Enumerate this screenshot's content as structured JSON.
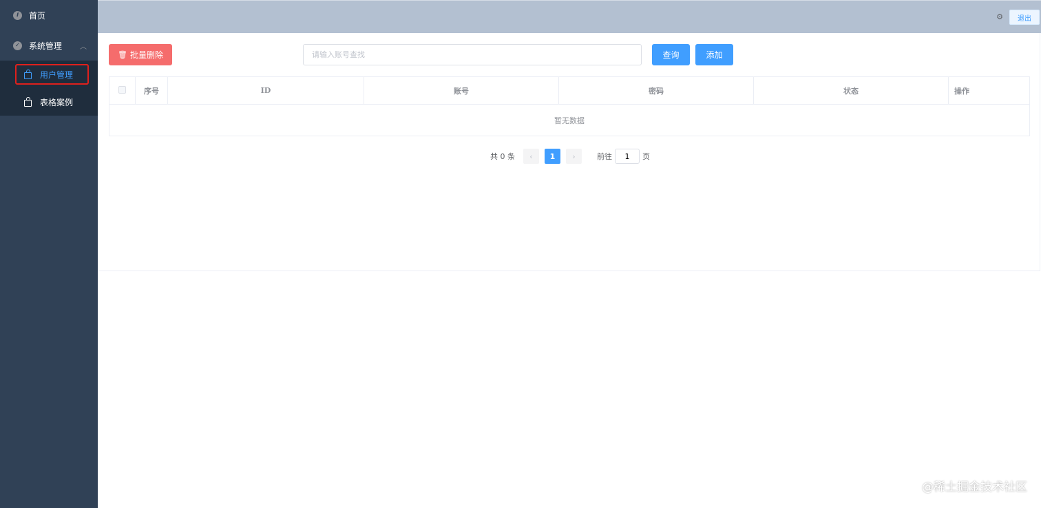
{
  "sidebar": {
    "items": [
      {
        "label": "首页",
        "icon": "info-icon"
      },
      {
        "label": "系统管理",
        "icon": "check-circle-icon",
        "expanded": true,
        "children": [
          {
            "label": "用户管理",
            "active": true,
            "icon": "bag-icon"
          },
          {
            "label": "表格案例",
            "icon": "bag-icon"
          }
        ]
      }
    ]
  },
  "header": {
    "settings_icon": "gear-icon",
    "logout_label": "退出"
  },
  "toolbar": {
    "batch_delete_label": "批量删除",
    "search_placeholder": "请输入账号查找",
    "search_value": "",
    "query_label": "查询",
    "add_label": "添加"
  },
  "table": {
    "columns": [
      "序号",
      "ID",
      "账号",
      "密码",
      "状态",
      "操作"
    ],
    "rows": [],
    "empty_text": "暂无数据"
  },
  "pagination": {
    "total_prefix": "共",
    "total": "0",
    "total_suffix": "条",
    "current_page": "1",
    "goto_prefix": "前往",
    "goto_value": "1",
    "goto_suffix": "页"
  },
  "watermark": "@稀土掘金技术社区",
  "colors": {
    "sidebar": "#304156",
    "header": "#b3c0d1",
    "primary": "#409eff",
    "danger": "#f56c6c"
  }
}
